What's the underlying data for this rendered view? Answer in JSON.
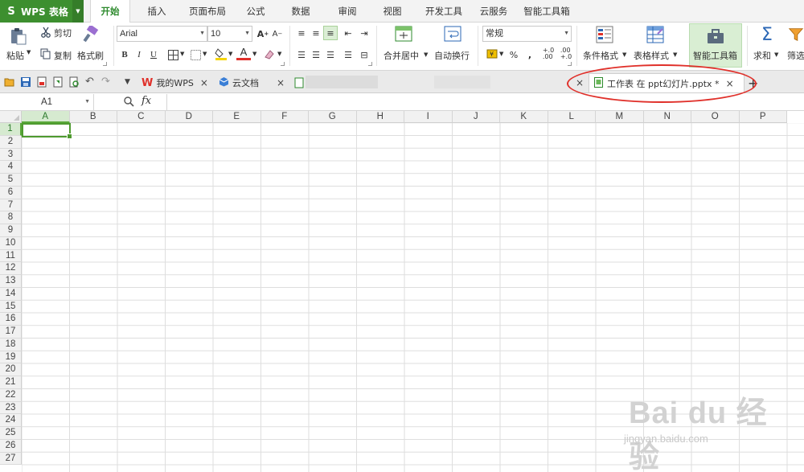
{
  "app": {
    "name": "WPS 表格"
  },
  "menu": {
    "tabs": [
      "开始",
      "插入",
      "页面布局",
      "公式",
      "数据",
      "审阅",
      "视图",
      "开发工具",
      "云服务",
      "智能工具箱"
    ],
    "active": "开始"
  },
  "ribbon": {
    "paste": "粘贴",
    "cut": "剪切",
    "copy": "复制",
    "format_painter": "格式刷",
    "font_name": "Arial",
    "font_size": "10",
    "merge_center": "合并居中",
    "wrap_text": "自动换行",
    "number_format": "常规",
    "conditional_format": "条件格式",
    "table_style": "表格样式",
    "smart_toolbox": "智能工具箱",
    "sum": "求和",
    "filter": "筛选",
    "percent": "%",
    "thousands": ",",
    "inc_decimal": "+.0\n.00",
    "dec_decimal": ".00\n+.0",
    "bold": "B",
    "italic": "I",
    "underline": "U",
    "font_color_letter": "A"
  },
  "tabbar": {
    "tabs": [
      {
        "label": "我的WPS",
        "close": "×"
      },
      {
        "label": "云文档",
        "close": "×"
      },
      {
        "label": "工作表 在 ppt幻灯片.pptx *",
        "close": "×"
      }
    ],
    "new_tab": "+",
    "left_close": "×"
  },
  "formula_bar": {
    "cell_ref": "A1",
    "fx": "fx",
    "value": ""
  },
  "sheet": {
    "columns": [
      "A",
      "B",
      "C",
      "D",
      "E",
      "F",
      "G",
      "H",
      "I",
      "J",
      "K",
      "L",
      "M",
      "N",
      "O",
      "P"
    ],
    "rows": [
      "1",
      "2",
      "3",
      "4",
      "5",
      "6",
      "7",
      "8",
      "9",
      "10",
      "11",
      "12",
      "13",
      "14",
      "15",
      "16",
      "17",
      "18",
      "19",
      "20",
      "21",
      "22",
      "23",
      "24",
      "25",
      "26",
      "27"
    ],
    "active_cell": "A1"
  },
  "watermark": {
    "main": "Bai du 经验",
    "sub": "jingyan.baidu.com"
  },
  "colors": {
    "accent": "#3d8f2f",
    "annotation": "#e0302a",
    "selection": "#4e9a2f"
  }
}
